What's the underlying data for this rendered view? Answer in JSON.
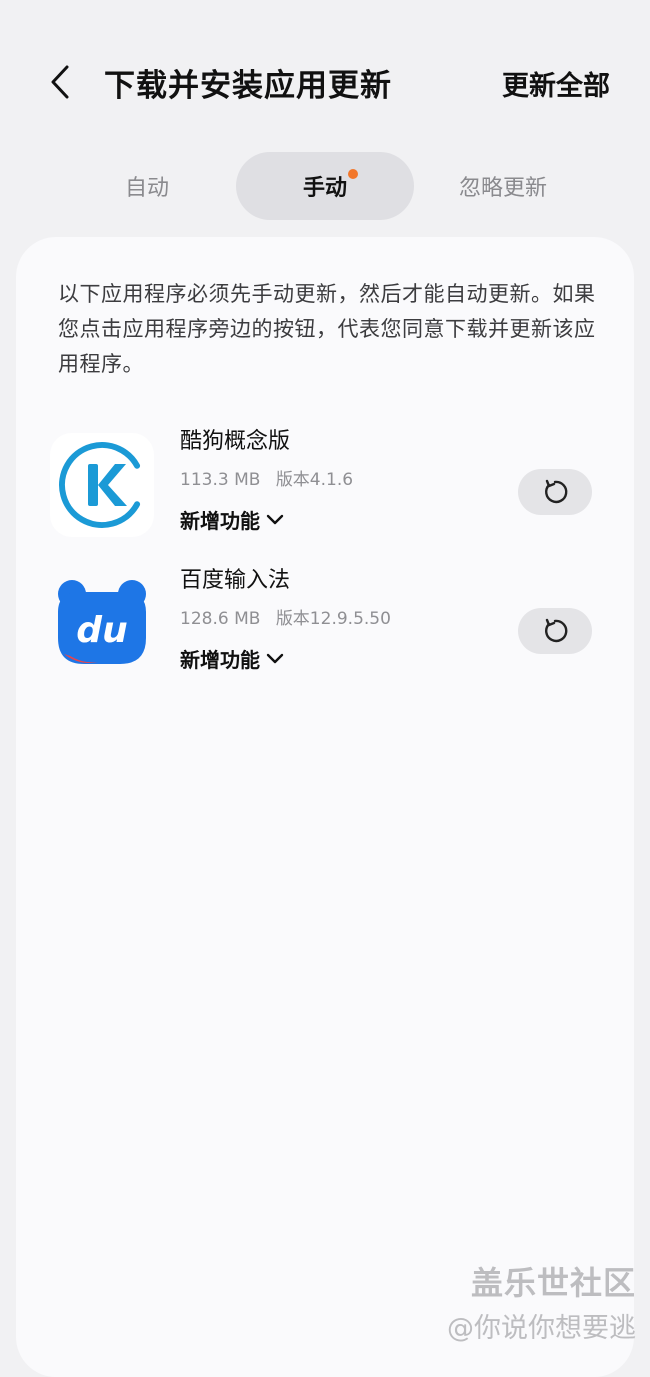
{
  "header": {
    "back_icon": "chevron-left-icon",
    "title": "下载并安装应用更新",
    "update_all_label": "更新全部"
  },
  "tabs": [
    {
      "label": "自动",
      "active": false
    },
    {
      "label": "手动",
      "active": true,
      "has_badge_dot": true
    },
    {
      "label": "忽略更新",
      "active": false
    }
  ],
  "colors": {
    "badge_dot": "#f2772b",
    "active_tab_bg": "#dfdfe3",
    "card_bg": "#fafafc",
    "page_bg": "#f1f1f3"
  },
  "notice": "以下应用程序必须先手动更新，然后才能自动更新。如果您点击应用程序旁边的按钮，代表您同意下载并更新该应用程序。",
  "apps": [
    {
      "name": "酷狗概念版",
      "size": "113.3 MB",
      "version": "版本4.1.6",
      "whats_new_label": "新增功能",
      "icon": "kugou-concept-logo",
      "update_icon": "refresh-icon"
    },
    {
      "name": "百度输入法",
      "size": "128.6 MB",
      "version": "版本12.9.5.50",
      "whats_new_label": "新增功能",
      "icon": "baidu-input-logo",
      "update_icon": "refresh-icon"
    }
  ],
  "watermark": {
    "line1": "盖乐世社区",
    "line2": "@你说你想要逃"
  }
}
